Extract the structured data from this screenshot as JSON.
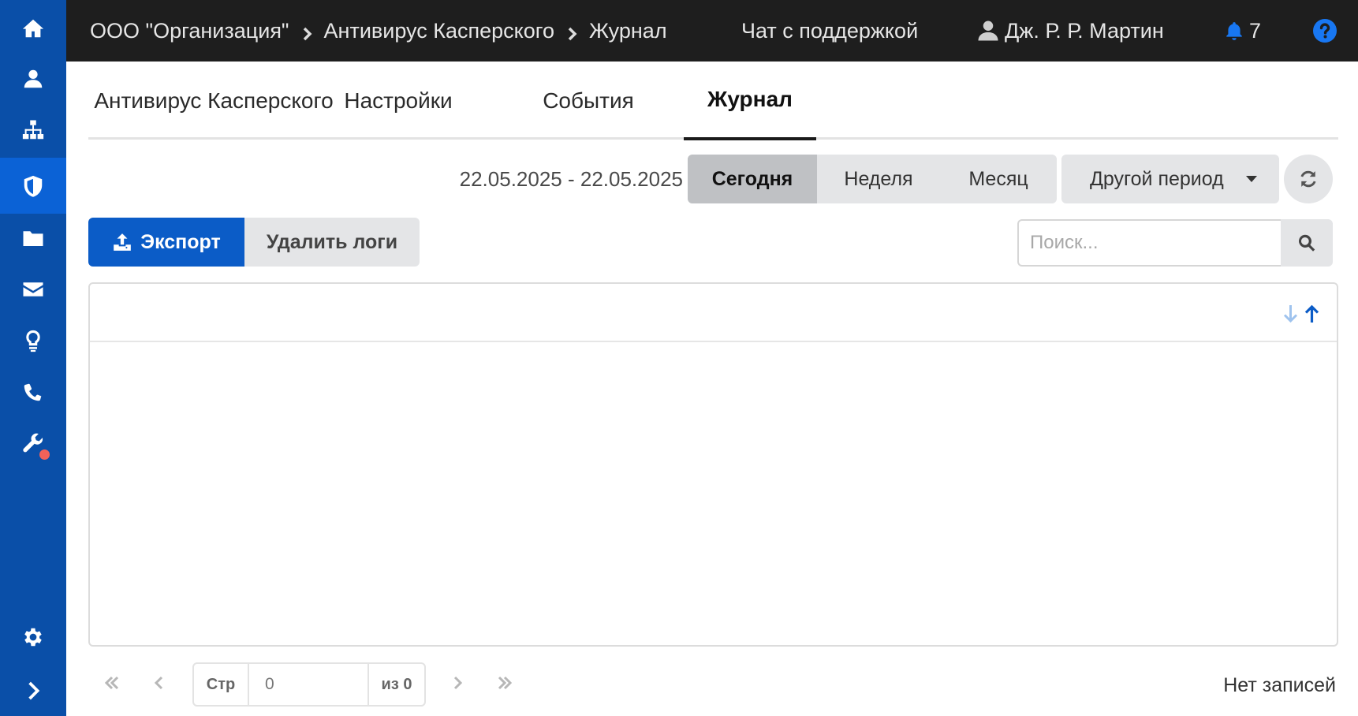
{
  "breadcrumb": [
    "ООО \"Организация\"",
    "Антивирус Касперского",
    "Журнал"
  ],
  "topbar": {
    "support_chat": "Чат с поддержкой",
    "user_name": "Дж. Р. Р. Мартин",
    "notifications_count": "7"
  },
  "sidebar": {
    "items": [
      {
        "icon": "home-icon"
      },
      {
        "icon": "user-icon"
      },
      {
        "icon": "sitemap-icon"
      },
      {
        "icon": "shield-icon",
        "active": true
      },
      {
        "icon": "folder-icon"
      },
      {
        "icon": "mail-icon"
      },
      {
        "icon": "lightbulb-icon"
      },
      {
        "icon": "phone-icon"
      },
      {
        "icon": "wrench-icon",
        "has_badge": true
      },
      {
        "icon": "settings-icon"
      },
      {
        "icon": "chevron-right-icon"
      }
    ]
  },
  "tabs": [
    {
      "label": "Антивирус Касперского"
    },
    {
      "label": "Настройки"
    },
    {
      "label": "События"
    },
    {
      "label": "Журнал",
      "active": true
    }
  ],
  "period": {
    "date_range": "22.05.2025 - 22.05.2025",
    "options": [
      "Сегодня",
      "Неделя",
      "Месяц"
    ],
    "selected": "Сегодня",
    "other": "Другой период"
  },
  "actions": {
    "export_label": "Экспорт",
    "delete_label": "Удалить логи"
  },
  "search": {
    "placeholder": "Поиск...",
    "value": ""
  },
  "pagination": {
    "page_label": "Стр",
    "page_value": "0",
    "of_label": "из 0",
    "records_text": "Нет записей"
  },
  "colors": {
    "sidebar": "#0a4fa8",
    "sidebar_active": "#0b62d6",
    "topbar": "#1e1e1e",
    "primary": "#0b5cc7",
    "badge": "#f2625a"
  }
}
